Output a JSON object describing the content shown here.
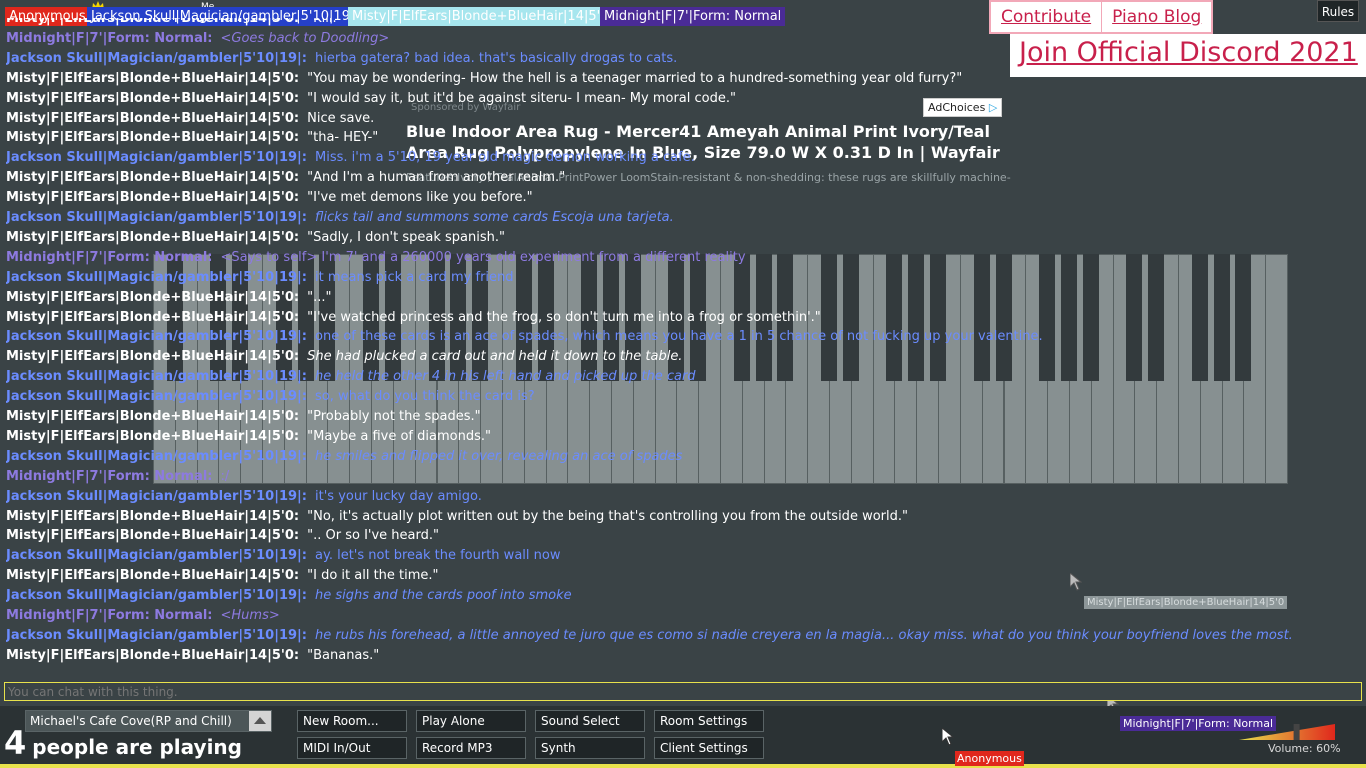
{
  "players": [
    {
      "name": "Anonymous",
      "color": "#e0271c"
    },
    {
      "name": "Jackson Skull|Magician/gambler|5'10|19|",
      "color": "#2540c9"
    },
    {
      "name": "Misty|F|ElfEars|Blonde+BlueHair|14|5'0",
      "color": "#a7e6ee"
    },
    {
      "name": "Midnight|F|7'|Form: Normal",
      "color": "#4a2b96"
    }
  ],
  "me_label": "Me",
  "links": {
    "contribute": "Contribute",
    "piano_blog": "Piano Blog",
    "discord": "Join Official Discord 2021",
    "rules": "Rules"
  },
  "ad": {
    "choices": "AdChoices",
    "small": "Sponsored by Wayfair",
    "title": "Blue Indoor Area Rug - Mercer41 Ameyah Animal Print Ivory/Teal Area Rug Polypropylene In Blue, Size 79.0 W X 0.31 D In | Wayfair",
    "desc": "Features:Ivory / TealAnimal PrintPower LoomStain-resistant & non-shedding: these rugs are skillfully machine-"
  },
  "messages": [
    {
      "n": "Misty|F|ElfEars|Blonde+BlueHair|14|5'0:",
      "t": "\"Kiii.\"",
      "c": "#ffffff",
      "i": false
    },
    {
      "n": "Midnight|F|7'|Form: Normal:",
      "t": "<Goes back to Doodling>",
      "c": "#8d7ae0",
      "i": true
    },
    {
      "n": "Jackson Skull|Magician/gambler|5'10|19|:",
      "t": "hierba gatera? bad idea. that's basically drogas to cats.",
      "c": "#6b8cff",
      "i": false
    },
    {
      "n": "Misty|F|ElfEars|Blonde+BlueHair|14|5'0:",
      "t": "\"You may be wondering- How the hell is a teenager married to a hundred-something year old furry?\"",
      "c": "#ffffff",
      "i": false
    },
    {
      "n": "Misty|F|ElfEars|Blonde+BlueHair|14|5'0:",
      "t": "\"I would say it, but it'd be against siteru- I mean- My moral code.\"",
      "c": "#ffffff",
      "i": false
    },
    {
      "n": "Misty|F|ElfEars|Blonde+BlueHair|14|5'0:",
      "t": "Nice save.",
      "c": "#ffffff",
      "i": false
    },
    {
      "n": "Misty|F|ElfEars|Blonde+BlueHair|14|5'0:",
      "t": "\"tha- HEY-\"",
      "c": "#ffffff",
      "i": false
    },
    {
      "n": "Jackson Skull|Magician/gambler|5'10|19|:",
      "t": "Miss. i'm a 5'10, 19 year old magic demon working a cafe.",
      "c": "#6b8cff",
      "i": false
    },
    {
      "n": "Misty|F|ElfEars|Blonde+BlueHair|14|5'0:",
      "t": "\"And I'm a human from another realm.\"",
      "c": "#ffffff",
      "i": false
    },
    {
      "n": "Misty|F|ElfEars|Blonde+BlueHair|14|5'0:",
      "t": "\"I've met demons like you before.\"",
      "c": "#ffffff",
      "i": false
    },
    {
      "n": "Jackson Skull|Magician/gambler|5'10|19|:",
      "t": "flicks tail and summons some cards Escoja una tarjeta.",
      "c": "#6b8cff",
      "i": true
    },
    {
      "n": "Misty|F|ElfEars|Blonde+BlueHair|14|5'0:",
      "t": "\"Sadly, I don't speak spanish.\"",
      "c": "#ffffff",
      "i": false
    },
    {
      "n": "Midnight|F|7'|Form: Normal:",
      "t": "<Says to self> I'm 7' and a 260000 years old experiment from a different reality",
      "c": "#8d7ae0",
      "i": false
    },
    {
      "n": "Jackson Skull|Magician/gambler|5'10|19|:",
      "t": "it means pick a card my friend",
      "c": "#6b8cff",
      "i": false
    },
    {
      "n": "Misty|F|ElfEars|Blonde+BlueHair|14|5'0:",
      "t": "\"...\"",
      "c": "#ffffff",
      "i": false
    },
    {
      "n": "Misty|F|ElfEars|Blonde+BlueHair|14|5'0:",
      "t": "\"I've watched princess and the frog, so don't turn me into a frog or somethin'.\"",
      "c": "#ffffff",
      "i": false
    },
    {
      "n": "Jackson Skull|Magician/gambler|5'10|19|:",
      "t": "one of these cards is an ace of spades, which means you have a 1 in 5 chance of not fucking up your valentine.",
      "c": "#6b8cff",
      "i": false
    },
    {
      "n": "Misty|F|ElfEars|Blonde+BlueHair|14|5'0:",
      "t": "She had plucked a card out and held it down to the table.",
      "c": "#ffffff",
      "i": true
    },
    {
      "n": "Jackson Skull|Magician/gambler|5'10|19|:",
      "t": "he held the other 4 in his left hand and picked up the card",
      "c": "#6b8cff",
      "i": true
    },
    {
      "n": "Jackson Skull|Magician/gambler|5'10|19|:",
      "t": "so, what do you think the card is?",
      "c": "#6b8cff",
      "i": false
    },
    {
      "n": "Misty|F|ElfEars|Blonde+BlueHair|14|5'0:",
      "t": "\"Probably not the spades.\"",
      "c": "#ffffff",
      "i": false
    },
    {
      "n": "Misty|F|ElfEars|Blonde+BlueHair|14|5'0:",
      "t": "\"Maybe a five of diamonds.\"",
      "c": "#ffffff",
      "i": false
    },
    {
      "n": "Jackson Skull|Magician/gambler|5'10|19|:",
      "t": "he smiles and flipped it over, revealing an ace of spades",
      "c": "#6b8cff",
      "i": true
    },
    {
      "n": "Midnight|F|7'|Form: Normal:",
      "t": ":/",
      "c": "#8d7ae0",
      "i": false
    },
    {
      "n": "Jackson Skull|Magician/gambler|5'10|19|:",
      "t": "it's your lucky day amigo.",
      "c": "#6b8cff",
      "i": false
    },
    {
      "n": "Misty|F|ElfEars|Blonde+BlueHair|14|5'0:",
      "t": "\"No, it's actually plot written out by the being that's controlling you from the outside world.\"",
      "c": "#ffffff",
      "i": false
    },
    {
      "n": "Misty|F|ElfEars|Blonde+BlueHair|14|5'0:",
      "t": "\".. Or so I've heard.\"",
      "c": "#ffffff",
      "i": false
    },
    {
      "n": "Jackson Skull|Magician/gambler|5'10|19|:",
      "t": "ay. let's not break the fourth wall now",
      "c": "#6b8cff",
      "i": false
    },
    {
      "n": "Misty|F|ElfEars|Blonde+BlueHair|14|5'0:",
      "t": "\"I do it all the time.\"",
      "c": "#ffffff",
      "i": false
    },
    {
      "n": "Jackson Skull|Magician/gambler|5'10|19|:",
      "t": "he sighs and the cards poof into smoke",
      "c": "#6b8cff",
      "i": true
    },
    {
      "n": "Midnight|F|7'|Form: Normal:",
      "t": "<Hums>",
      "c": "#8d7ae0",
      "i": true
    },
    {
      "n": "Jackson Skull|Magician/gambler|5'10|19|:",
      "t": "he rubs his forehead, a little annoyed te juro que es como si nadie creyera en la magia... okay miss. what do you think your boyfriend loves the most.",
      "c": "#6b8cff",
      "i": true
    },
    {
      "n": "Misty|F|ElfEars|Blonde+BlueHair|14|5'0:",
      "t": "\"Bananas.\"",
      "c": "#ffffff",
      "i": false
    }
  ],
  "chat_placeholder": "You can chat with this thing.",
  "room": {
    "name": "Michael's Cafe Cove(RP and Chill)"
  },
  "people": {
    "count": "4",
    "text": "people are playing"
  },
  "buttons": {
    "new_room": "New Room...",
    "play_alone": "Play Alone",
    "sound_select": "Sound Select",
    "room_settings": "Room Settings",
    "midi": "MIDI In/Out",
    "record": "Record MP3",
    "synth": "Synth",
    "client_settings": "Client Settings"
  },
  "cursors": {
    "midnight": "Midnight|F|7'|Form: Normal",
    "anonymous": "Anonymous",
    "misty": "Misty|F|ElfEars|Blonde+BlueHair|14|5'0"
  },
  "volume": {
    "label": "Volume: 60%",
    "level": 0.6
  }
}
